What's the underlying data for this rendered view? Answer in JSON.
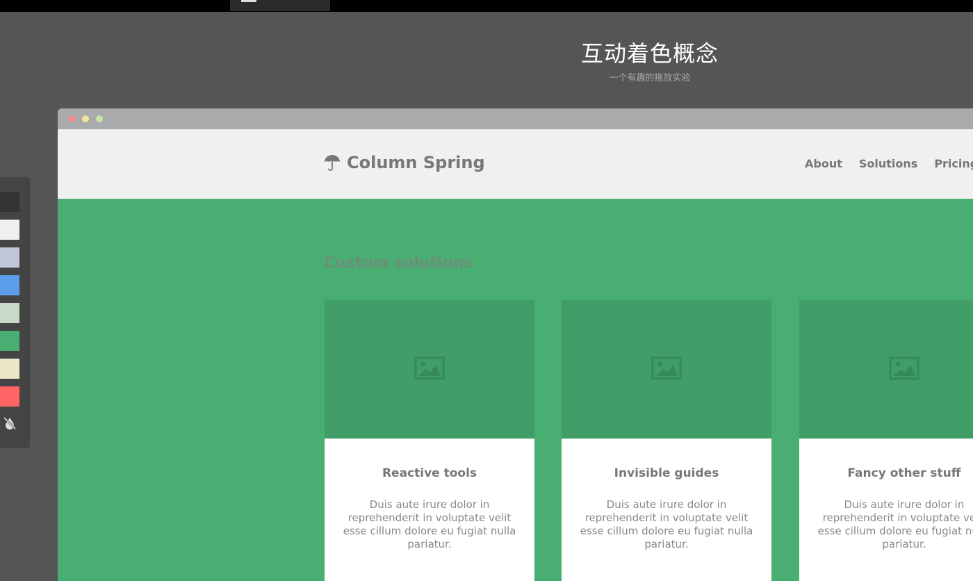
{
  "page": {
    "title": "互动着色概念",
    "subtitle": "一个有趣的拖放实验"
  },
  "palette": {
    "swatches": [
      "#333333",
      "#f0f0f0",
      "#c2c6da",
      "#5b9de8",
      "#c8d9c7",
      "#48ae72",
      "#ebe6c6",
      "#ff6464"
    ],
    "clear_icon": "no-color-icon"
  },
  "browser": {
    "dots": [
      "#f48a8a",
      "#f1e39a",
      "#c9e6a8"
    ]
  },
  "site": {
    "brand_icon": "umbrella-icon",
    "brand_name": "Column Spring",
    "nav": [
      "About",
      "Solutions",
      "Pricing"
    ],
    "section_title": "Custom solutions",
    "colors": {
      "header_bg": "#f0f0f0",
      "section_bg": "#48ae72",
      "image_bg": "#419e69"
    },
    "cards": [
      {
        "title": "Reactive tools",
        "body": "Duis aute irure dolor in reprehenderit in voluptate velit esse cillum dolore eu fugiat nulla pariatur."
      },
      {
        "title": "Invisible guides",
        "body": "Duis aute irure dolor in reprehenderit in voluptate velit esse cillum dolore eu fugiat nulla pariatur."
      },
      {
        "title": "Fancy other stuff",
        "body": "Duis aute irure dolor in reprehenderit in voluptate velit esse cillum dolore eu fugiat nulla pariatur."
      }
    ]
  }
}
